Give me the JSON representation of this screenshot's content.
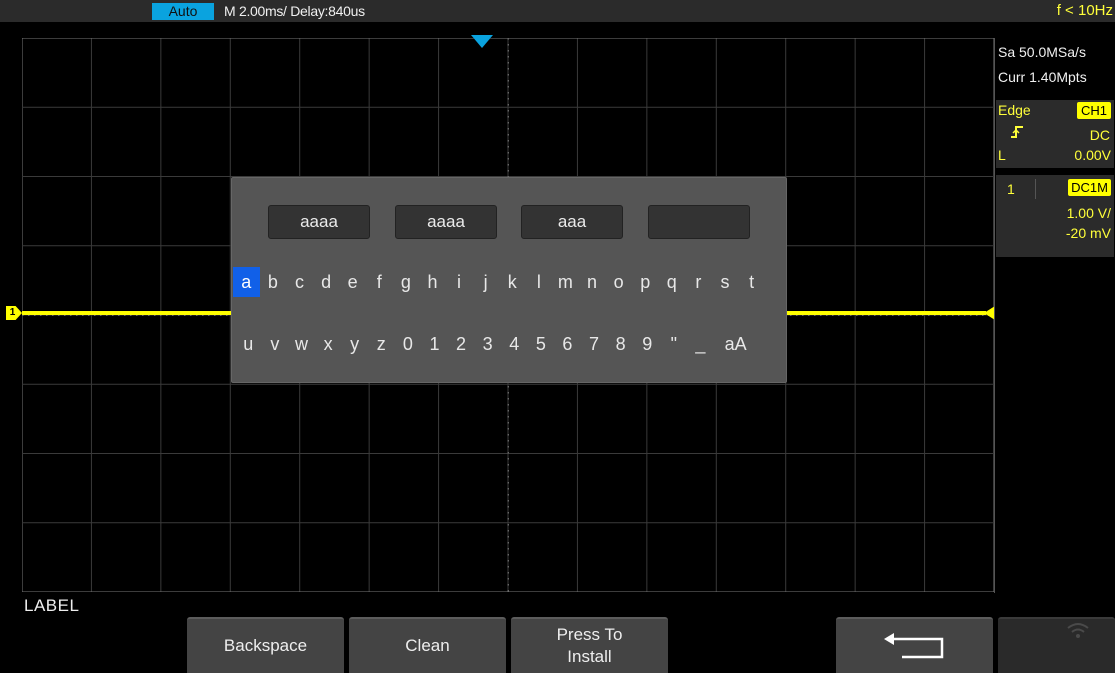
{
  "topbar": {
    "run_mode": "Auto",
    "timebase": "M 2.00ms/ Delay:840us",
    "frequency": "f < 10Hz"
  },
  "acquisition": {
    "sample_rate": "Sa 50.0MSa/s",
    "memory_depth": "Curr 1.40Mpts"
  },
  "trigger": {
    "type": "Edge",
    "source": "CH1",
    "slope_icon": "rising-edge-icon",
    "coupling": "DC",
    "level_prefix": "L",
    "level": "0.00V"
  },
  "channel1": {
    "number": "1",
    "coupling_impedance": "DC1M",
    "scale": "1.00 V/",
    "offset": "-20 mV",
    "marker": "1",
    "color": "#ffff00"
  },
  "keyboard": {
    "slots": [
      "aaaa",
      "aaaa",
      "aaa",
      ""
    ],
    "row1": [
      "a",
      "b",
      "c",
      "d",
      "e",
      "f",
      "g",
      "h",
      "i",
      "j",
      "k",
      "l",
      "m",
      "n",
      "o",
      "p",
      "q",
      "r",
      "s",
      "t"
    ],
    "row2": [
      "u",
      "v",
      "w",
      "x",
      "y",
      "z",
      "0",
      "1",
      "2",
      "3",
      "4",
      "5",
      "6",
      "7",
      "8",
      "9",
      "\"",
      "_",
      "aA"
    ],
    "selected_key": "a"
  },
  "footer": {
    "mode_label": "LABEL",
    "softkeys": {
      "backspace": "Backspace",
      "clean": "Clean",
      "press_to_line1": "Press To",
      "press_to_line2": "Install",
      "return_icon": "return-arrow-icon",
      "wifi_icon": "wifi-icon"
    }
  },
  "colors": {
    "accent": "#0aa3df",
    "trace": "#ffff00",
    "selection": "#1160e8"
  }
}
